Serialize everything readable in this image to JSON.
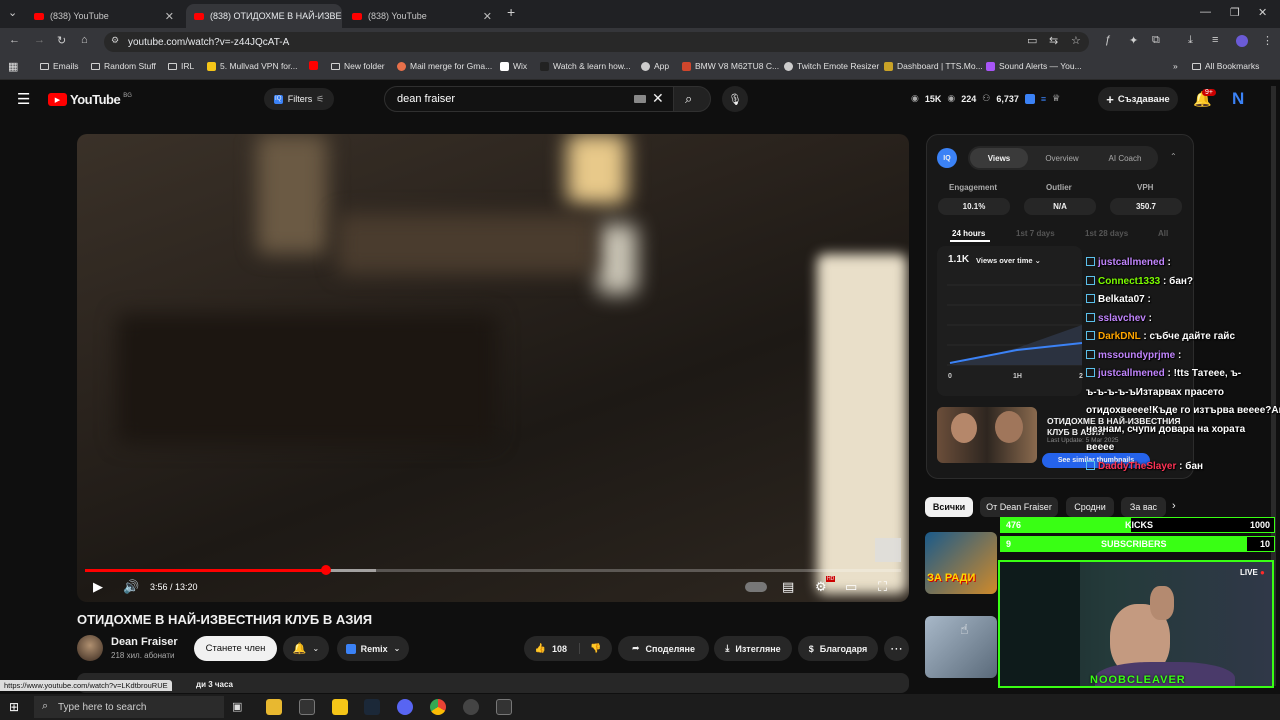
{
  "browser": {
    "tabs": [
      {
        "title": "(838) YouTube",
        "active": false
      },
      {
        "title": "(838) ОТИДОХМЕ В НАЙ-ИЗВЕСТ",
        "active": true
      },
      {
        "title": "(838) YouTube",
        "active": false
      }
    ],
    "url": "youtube.com/watch?v=-z44JQcAT-A",
    "status_url": "https://www.youtube.com/watch?v=LKdtbrouRUE",
    "bookmarks": [
      "Emails",
      "Random Stuff",
      "IRL",
      "5. Mullvad VPN for...",
      "New folder",
      "Mail merge for Gma...",
      "Wix",
      "Watch & learn how...",
      "App",
      "BMW V8 M62TU8 C...",
      "Twitch Emote Resizer",
      "Dashboard | TTS.Mo...",
      "Sound Alerts — You..."
    ],
    "all_bookmarks": "All Bookmarks"
  },
  "youtube": {
    "logo": "YouTube",
    "region": "BG",
    "filters": "Filters",
    "search_value": "dean fraiser",
    "stats": {
      "a": "15K",
      "b": "224",
      "c": "6,737"
    },
    "create": "Създаване",
    "notif": "9+",
    "avatar_letter": "N"
  },
  "video": {
    "time": "3:56 / 13:20",
    "progress": 0.295,
    "buffered": 0.357,
    "title": "ОТИДОХМЕ В НАЙ-ИЗВЕСТНИЯ КЛУБ В АЗИЯ",
    "channel": "Dean Fraiser",
    "subs": "218 хил. абонати",
    "join": "Станете член",
    "remix": "Remix",
    "likes": "108",
    "share": "Споделяне",
    "download": "Изтегляне",
    "thanks": "Благодаря",
    "views_line": "ди 3 часа"
  },
  "iq": {
    "tabs": [
      "Views",
      "Overview",
      "AI Coach"
    ],
    "labels": [
      "Engagement",
      "Outlier",
      "VPH"
    ],
    "values": [
      "10.1%",
      "N/A",
      "350.7"
    ],
    "ranges": [
      "24 hours",
      "1st 7 days",
      "1st 28 days",
      "All"
    ],
    "count": "1.1K",
    "dropdown": "Views over time",
    "axis": [
      "0",
      "1H",
      "2"
    ],
    "similar_title": "ОТИДОХМЕ В НАЙ-ИЗВЕСТНИЯ КЛУБ В АЗИЯ",
    "last_update": "Last Update: 5 Mar 2025",
    "see_similar": "See similar thumbnails"
  },
  "chat": [
    {
      "user": "justcallmened",
      "msg": " : ",
      "color": "#c084fc"
    },
    {
      "user": "Connect1333",
      "msg": " : бан?",
      "color": "#7cfc00"
    },
    {
      "user": "Belkata07",
      "msg": " : ",
      "color": "#ffffff"
    },
    {
      "user": "sslavchev",
      "msg": " : ",
      "color": "#c084fc"
    },
    {
      "user": "DarkDNL",
      "msg": " : събче дайте гайс",
      "color": "#ffa500"
    },
    {
      "user": "mssoundyprjme",
      "msg": " : ",
      "color": "#c084fc"
    },
    {
      "user": "justcallmened",
      "msg": " : !tts Татеее, ъ-",
      "color": "#c084fc"
    },
    {
      "user": "",
      "msg": "ъ-ъ-ъ-ъ-ъИзтарвах прасето",
      "color": "#fff"
    },
    {
      "user": "",
      "msg": "отидохвееее!Къде го изтърва вееее?Аве",
      "color": "#fff"
    },
    {
      "user": "",
      "msg": "незнам, счупи довара на хората",
      "color": "#fff"
    },
    {
      "user": "",
      "msg": "вееее",
      "color": "#fff"
    },
    {
      "user": "DaddyTheSlayer",
      "msg": " : бан",
      "color": "#ff3355"
    }
  ],
  "chips": [
    "Всички",
    "От Dean Fraiser",
    "Сродни",
    "За вас"
  ],
  "goals": [
    {
      "left": "476",
      "label": "KICKS",
      "right": "1000",
      "fraction": 0.476
    },
    {
      "left": "9",
      "label": "SUBSCRIBERS",
      "right": "10",
      "fraction": 0.9
    }
  ],
  "cam": {
    "live": "LIVE",
    "name": "NOOBCLEAVER"
  },
  "side_thumb_text": "ЗА РАДИ",
  "taskbar": {
    "search": "Type here to search"
  },
  "colors": {
    "accent": "#ff0000",
    "goal": "#39ff14",
    "iq_blue": "#3b82f6"
  }
}
